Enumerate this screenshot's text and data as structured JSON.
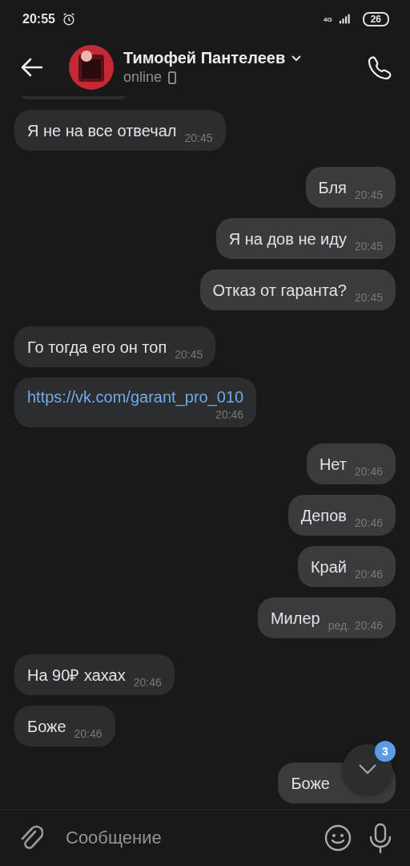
{
  "status_bar": {
    "time": "20:55",
    "network": "4G",
    "battery": "26"
  },
  "header": {
    "name": "Тимофей Пантелеев",
    "status": "online"
  },
  "messages": [
    {
      "kind": "text",
      "outgoing": false,
      "text": "Я не на все отвечал",
      "time": "20:45"
    },
    {
      "kind": "text",
      "outgoing": true,
      "text": "Бля",
      "time": "20:45"
    },
    {
      "kind": "text",
      "outgoing": true,
      "text": "Я на дов не иду",
      "time": "20:45"
    },
    {
      "kind": "text",
      "outgoing": true,
      "text": "Отказ от гаранта?",
      "time": "20:45"
    },
    {
      "kind": "text",
      "outgoing": false,
      "text": "Го тогда его он топ",
      "time": "20:45"
    },
    {
      "kind": "link",
      "outgoing": false,
      "text": "https://vk.com/garant_pro_010",
      "time": "20:46"
    },
    {
      "kind": "text",
      "outgoing": true,
      "text": "Нет",
      "time": "20:46"
    },
    {
      "kind": "text",
      "outgoing": true,
      "text": "Депов",
      "time": "20:46"
    },
    {
      "kind": "text",
      "outgoing": true,
      "text": "Край",
      "time": "20:46"
    },
    {
      "kind": "text",
      "outgoing": true,
      "text": "Милер",
      "time": "20:46",
      "edited": "ред."
    },
    {
      "kind": "text",
      "outgoing": false,
      "text": "На 90₽ хахах",
      "time": "20:46"
    },
    {
      "kind": "text",
      "outgoing": false,
      "text": "Боже",
      "time": "20:46"
    },
    {
      "kind": "text",
      "outgoing": true,
      "text": "Боже"
    }
  ],
  "scroll_button": {
    "badge": "3"
  },
  "composer": {
    "placeholder": "Сообщение"
  }
}
